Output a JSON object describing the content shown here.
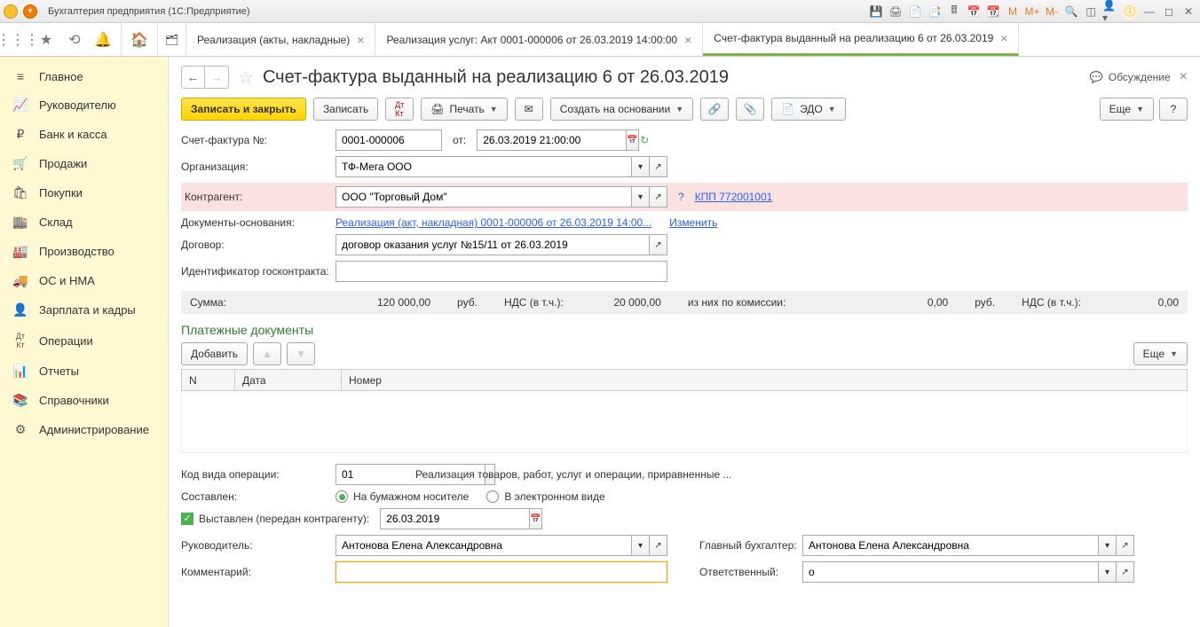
{
  "titlebar": {
    "title": "Бухгалтерия предприятия  (1С:Предприятие)"
  },
  "tabs": [
    {
      "label": "Реализация (акты, накладные)"
    },
    {
      "label": "Реализация услуг: Акт 0001-000006 от 26.03.2019 14:00:00"
    },
    {
      "label": "Счет-фактура выданный на реализацию 6 от 26.03.2019"
    }
  ],
  "sidebar": [
    {
      "icon": "≡",
      "label": "Главное"
    },
    {
      "icon": "📈",
      "label": "Руководителю"
    },
    {
      "icon": "₽",
      "label": "Банк и касса"
    },
    {
      "icon": "🛒",
      "label": "Продажи"
    },
    {
      "icon": "🛍",
      "label": "Покупки"
    },
    {
      "icon": "🏬",
      "label": "Склад"
    },
    {
      "icon": "🏭",
      "label": "Производство"
    },
    {
      "icon": "🚚",
      "label": "ОС и НМА"
    },
    {
      "icon": "👤",
      "label": "Зарплата и кадры"
    },
    {
      "icon": "Дт/Кт",
      "label": "Операции"
    },
    {
      "icon": "📊",
      "label": "Отчеты"
    },
    {
      "icon": "📚",
      "label": "Справочники"
    },
    {
      "icon": "⚙",
      "label": "Администрирование"
    }
  ],
  "page": {
    "title": "Счет-фактура выданный на реализацию 6 от 26.03.2019",
    "discuss": "Обсуждение",
    "actions": {
      "save_close": "Записать и закрыть",
      "save": "Записать",
      "print": "Печать",
      "create_from": "Создать на основании",
      "edo": "ЭДО",
      "more": "Еще"
    },
    "fields": {
      "invoice_no_label": "Счет-фактура №:",
      "invoice_no": "0001-000006",
      "from_label": "от:",
      "from_date": "26.03.2019 21:00:00",
      "org_label": "Организация:",
      "org": "ТФ-Мега ООО",
      "counterparty_label": "Контрагент:",
      "counterparty": "ООО \"Торговый Дом\"",
      "kpp": "КПП 772001001",
      "basis_docs_label": "Документы-основания:",
      "basis_doc_link": "Реализация (акт, накладная) 0001-000006 от 26.03.2019 14:00...",
      "change_link": "Изменить",
      "contract_label": "Договор:",
      "contract": "договор оказания услуг №15/11 от 26.03.2019",
      "goscontract_label": "Идентификатор госконтракта:",
      "goscontract": ""
    },
    "summary": {
      "sum_label": "Сумма:",
      "sum": "120 000,00",
      "rub": "руб.",
      "vat_label": "НДС (в т.ч.):",
      "vat": "20 000,00",
      "commission_label": "из них по комиссии:",
      "commission": "0,00",
      "rub2": "руб.",
      "vat2_label": "НДС (в т.ч.):",
      "vat2": "0,00"
    },
    "payments": {
      "title": "Платежные документы",
      "add": "Добавить",
      "more": "Еще",
      "cols": {
        "n": "N",
        "date": "Дата",
        "number": "Номер"
      }
    },
    "op_code_label": "Код вида операции:",
    "op_code": "01",
    "op_code_desc": "Реализация товаров, работ, услуг и операции, приравненные ...",
    "composed_label": "Составлен:",
    "composed_paper": "На бумажном носителе",
    "composed_electronic": "В электронном виде",
    "issued_label": "Выставлен (передан контрагенту):",
    "issued_date": "26.03.2019",
    "manager": {
      "label": "Руководитель:",
      "value": "Антонова Елена Александровна",
      "chief_label": "Главный бухгалтер:",
      "chief_value": "Антонова Елена Александровна"
    },
    "comment_label": "Комментарий:",
    "comment": "",
    "responsible_label": "Ответственный:",
    "responsible": "o"
  }
}
